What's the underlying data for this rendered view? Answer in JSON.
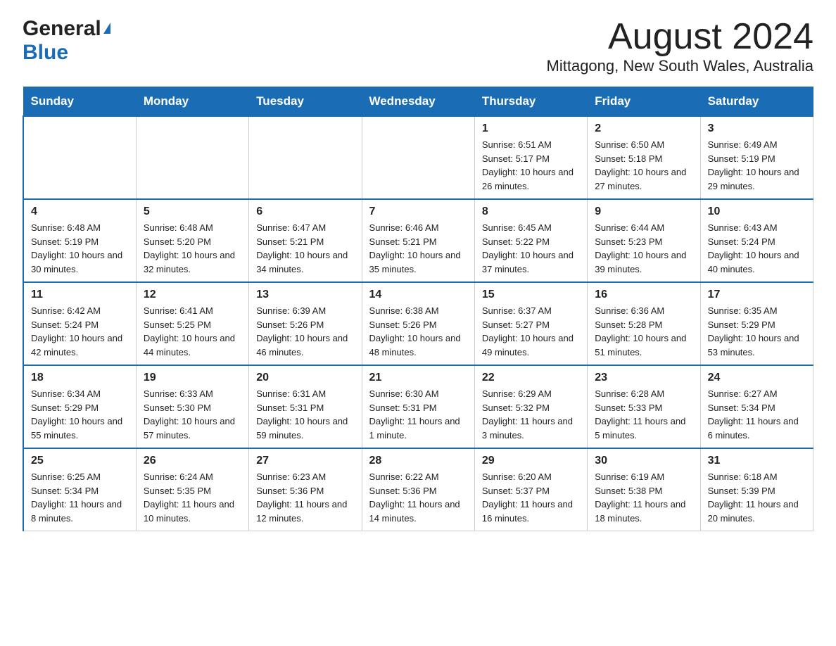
{
  "header": {
    "logo_general": "General",
    "logo_blue": "Blue",
    "month_title": "August 2024",
    "location": "Mittagong, New South Wales, Australia"
  },
  "weekdays": [
    "Sunday",
    "Monday",
    "Tuesday",
    "Wednesday",
    "Thursday",
    "Friday",
    "Saturday"
  ],
  "weeks": [
    [
      {
        "day": "",
        "info": ""
      },
      {
        "day": "",
        "info": ""
      },
      {
        "day": "",
        "info": ""
      },
      {
        "day": "",
        "info": ""
      },
      {
        "day": "1",
        "info": "Sunrise: 6:51 AM\nSunset: 5:17 PM\nDaylight: 10 hours and 26 minutes."
      },
      {
        "day": "2",
        "info": "Sunrise: 6:50 AM\nSunset: 5:18 PM\nDaylight: 10 hours and 27 minutes."
      },
      {
        "day": "3",
        "info": "Sunrise: 6:49 AM\nSunset: 5:19 PM\nDaylight: 10 hours and 29 minutes."
      }
    ],
    [
      {
        "day": "4",
        "info": "Sunrise: 6:48 AM\nSunset: 5:19 PM\nDaylight: 10 hours and 30 minutes."
      },
      {
        "day": "5",
        "info": "Sunrise: 6:48 AM\nSunset: 5:20 PM\nDaylight: 10 hours and 32 minutes."
      },
      {
        "day": "6",
        "info": "Sunrise: 6:47 AM\nSunset: 5:21 PM\nDaylight: 10 hours and 34 minutes."
      },
      {
        "day": "7",
        "info": "Sunrise: 6:46 AM\nSunset: 5:21 PM\nDaylight: 10 hours and 35 minutes."
      },
      {
        "day": "8",
        "info": "Sunrise: 6:45 AM\nSunset: 5:22 PM\nDaylight: 10 hours and 37 minutes."
      },
      {
        "day": "9",
        "info": "Sunrise: 6:44 AM\nSunset: 5:23 PM\nDaylight: 10 hours and 39 minutes."
      },
      {
        "day": "10",
        "info": "Sunrise: 6:43 AM\nSunset: 5:24 PM\nDaylight: 10 hours and 40 minutes."
      }
    ],
    [
      {
        "day": "11",
        "info": "Sunrise: 6:42 AM\nSunset: 5:24 PM\nDaylight: 10 hours and 42 minutes."
      },
      {
        "day": "12",
        "info": "Sunrise: 6:41 AM\nSunset: 5:25 PM\nDaylight: 10 hours and 44 minutes."
      },
      {
        "day": "13",
        "info": "Sunrise: 6:39 AM\nSunset: 5:26 PM\nDaylight: 10 hours and 46 minutes."
      },
      {
        "day": "14",
        "info": "Sunrise: 6:38 AM\nSunset: 5:26 PM\nDaylight: 10 hours and 48 minutes."
      },
      {
        "day": "15",
        "info": "Sunrise: 6:37 AM\nSunset: 5:27 PM\nDaylight: 10 hours and 49 minutes."
      },
      {
        "day": "16",
        "info": "Sunrise: 6:36 AM\nSunset: 5:28 PM\nDaylight: 10 hours and 51 minutes."
      },
      {
        "day": "17",
        "info": "Sunrise: 6:35 AM\nSunset: 5:29 PM\nDaylight: 10 hours and 53 minutes."
      }
    ],
    [
      {
        "day": "18",
        "info": "Sunrise: 6:34 AM\nSunset: 5:29 PM\nDaylight: 10 hours and 55 minutes."
      },
      {
        "day": "19",
        "info": "Sunrise: 6:33 AM\nSunset: 5:30 PM\nDaylight: 10 hours and 57 minutes."
      },
      {
        "day": "20",
        "info": "Sunrise: 6:31 AM\nSunset: 5:31 PM\nDaylight: 10 hours and 59 minutes."
      },
      {
        "day": "21",
        "info": "Sunrise: 6:30 AM\nSunset: 5:31 PM\nDaylight: 11 hours and 1 minute."
      },
      {
        "day": "22",
        "info": "Sunrise: 6:29 AM\nSunset: 5:32 PM\nDaylight: 11 hours and 3 minutes."
      },
      {
        "day": "23",
        "info": "Sunrise: 6:28 AM\nSunset: 5:33 PM\nDaylight: 11 hours and 5 minutes."
      },
      {
        "day": "24",
        "info": "Sunrise: 6:27 AM\nSunset: 5:34 PM\nDaylight: 11 hours and 6 minutes."
      }
    ],
    [
      {
        "day": "25",
        "info": "Sunrise: 6:25 AM\nSunset: 5:34 PM\nDaylight: 11 hours and 8 minutes."
      },
      {
        "day": "26",
        "info": "Sunrise: 6:24 AM\nSunset: 5:35 PM\nDaylight: 11 hours and 10 minutes."
      },
      {
        "day": "27",
        "info": "Sunrise: 6:23 AM\nSunset: 5:36 PM\nDaylight: 11 hours and 12 minutes."
      },
      {
        "day": "28",
        "info": "Sunrise: 6:22 AM\nSunset: 5:36 PM\nDaylight: 11 hours and 14 minutes."
      },
      {
        "day": "29",
        "info": "Sunrise: 6:20 AM\nSunset: 5:37 PM\nDaylight: 11 hours and 16 minutes."
      },
      {
        "day": "30",
        "info": "Sunrise: 6:19 AM\nSunset: 5:38 PM\nDaylight: 11 hours and 18 minutes."
      },
      {
        "day": "31",
        "info": "Sunrise: 6:18 AM\nSunset: 5:39 PM\nDaylight: 11 hours and 20 minutes."
      }
    ]
  ],
  "colors": {
    "header_bg": "#1a6db5",
    "header_text": "#ffffff",
    "logo_blue": "#1a6db5",
    "border": "#cccccc",
    "week_border": "#1a6db5"
  }
}
